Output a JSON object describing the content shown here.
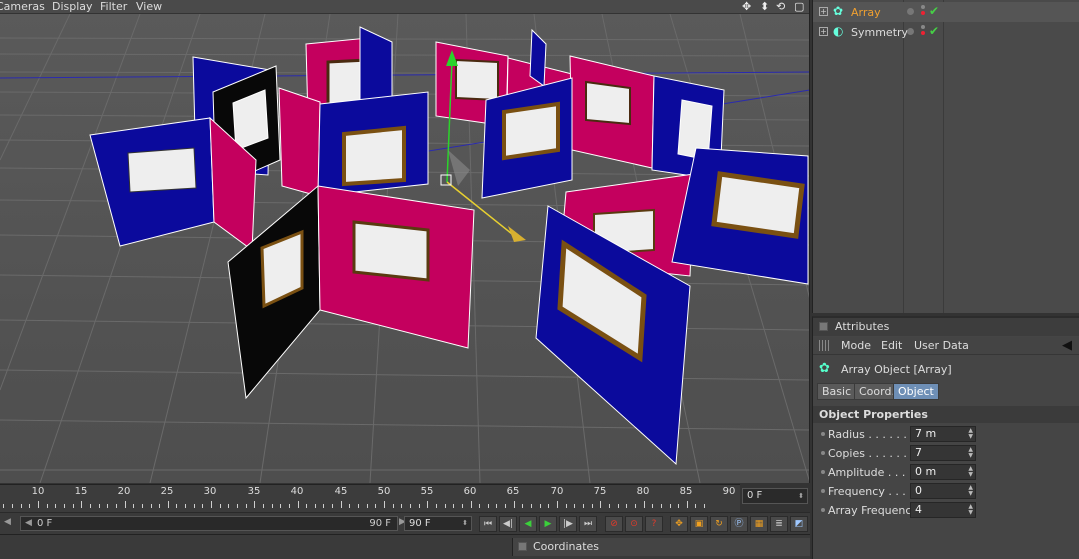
{
  "viewport": {
    "menu": [
      "Cameras",
      "Display",
      "Filter",
      "View"
    ]
  },
  "timeline": {
    "ticks": [
      "10",
      "15",
      "20",
      "25",
      "30",
      "35",
      "40",
      "45",
      "50",
      "55",
      "60",
      "65",
      "70",
      "75",
      "80",
      "85",
      "90"
    ],
    "current_frame": "0 F",
    "range_start": "0 F",
    "range_end": "90 F",
    "end_frame": "90 F"
  },
  "coordinates": {
    "title": "Coordinates"
  },
  "object_manager": {
    "objects": [
      {
        "name": "Array",
        "color": "#f0a030",
        "icon": "array-icon"
      },
      {
        "name": "Symmetry",
        "color": "#dddddd",
        "icon": "symmetry-icon"
      }
    ]
  },
  "attributes": {
    "title": "Attributes",
    "menu": [
      "Mode",
      "Edit",
      "User Data"
    ],
    "object_label": "Array Object [Array]",
    "tabs": [
      "Basic",
      "Coord.",
      "Object"
    ],
    "active_tab": "Object",
    "section_title": "Object Properties",
    "properties": [
      {
        "label": "Radius . . . . . . .",
        "value": "7 m"
      },
      {
        "label": "Copies . . . . . . .",
        "value": "7"
      },
      {
        "label": "Amplitude . . . . .",
        "value": "0 m"
      },
      {
        "label": "Frequency . . . .",
        "value": "0"
      },
      {
        "label": "Array Frequency",
        "value": "4"
      }
    ]
  },
  "colors": {
    "panel_blue": "#0b0a9c",
    "panel_magenta": "#c4005e",
    "panel_black": "#080808",
    "grid": "#6e6e6e",
    "accent_tab": "#6e8fb6"
  }
}
